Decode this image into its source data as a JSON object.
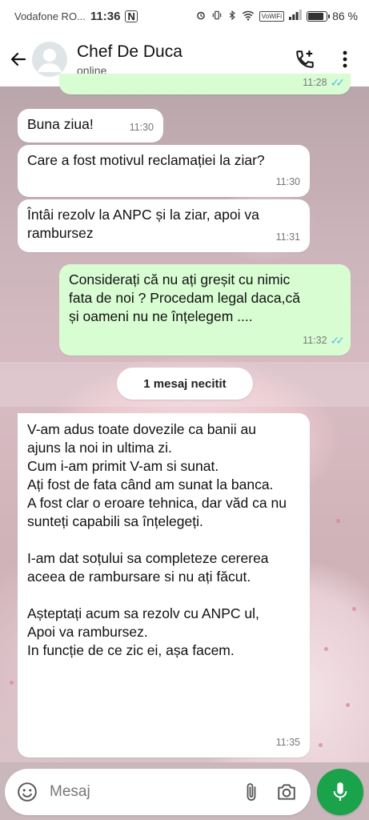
{
  "status_bar": {
    "carrier": "Vodafone RO...",
    "time": "11:36",
    "nfc": "N",
    "vowifi": "VoWiFi",
    "battery": "86 %",
    "battery_level": 0.86
  },
  "header": {
    "contact_name": "Chef De Duca",
    "contact_status": "online"
  },
  "messages": [
    {
      "direction": "out",
      "text": "",
      "time": "11:28",
      "read": true
    },
    {
      "direction": "in",
      "text": "Buna ziua!",
      "time": "11:30"
    },
    {
      "direction": "in",
      "text": "Care a fost motivul reclamației la ziar?",
      "time": "11:30"
    },
    {
      "direction": "in",
      "text": "Întâi rezolv la ANPC și la ziar, apoi va rambursez",
      "time": "11:31"
    },
    {
      "direction": "out",
      "text": "Considerați că nu ați greșit cu nimic fata de noi ? Procedam legal daca,că și oameni nu ne înțelegem ....",
      "time": "11:32",
      "read": true
    },
    {
      "direction": "in",
      "text": "V-am adus toate dovezile ca banii au ajuns la noi in ultima zi.\nCum i-am primit V-am si sunat.\nAți fost de fata când am sunat la banca.\nA fost clar o eroare tehnica, dar văd ca nu sunteți capabili sa înțelegeți.\n\nI-am dat soțului sa completeze cererea aceea  de rambursare si nu ați făcut.\n\nAșteptați acum sa rezolv cu ANPC ul, Apoi va rambursez.\nIn funcție de ce zic ei, așa facem.",
      "time": "11:35"
    }
  ],
  "unread_divider": "1 mesaj necitit",
  "input": {
    "placeholder": "Mesaj"
  },
  "colors": {
    "incoming_bubble": "#ffffff",
    "outgoing_bubble": "#d9fdd3",
    "read_ticks": "#53bdeb",
    "mic_button": "#1aa34a"
  },
  "icons": {
    "back": "arrow-left-icon",
    "add_call": "phone-plus-icon",
    "menu": "more-vertical-icon",
    "emoji": "emoji-icon",
    "attach": "paperclip-icon",
    "camera": "camera-icon",
    "mic": "mic-icon"
  }
}
